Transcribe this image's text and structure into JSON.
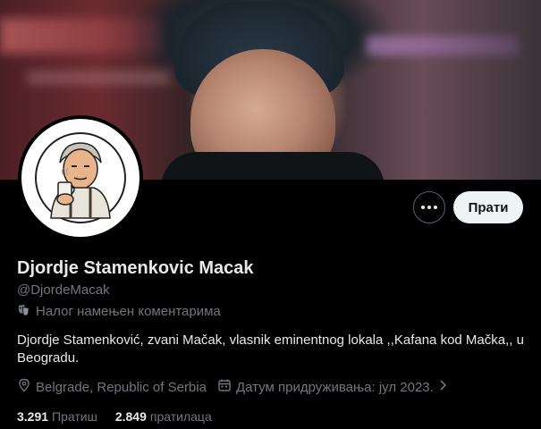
{
  "profile": {
    "name": "Djordje Stamenkovic Macak",
    "handle": "@DjordeMacak",
    "account_label": "Налог намењен коментарима",
    "bio": "Djordje Stamenković, zvani Mačak, vlasnik eminentnog lokala ,,Kafana kod Mačka,, u Beogradu.",
    "location": "Belgrade, Republic of Serbia",
    "joined": "Датум придруживања: јул 2023."
  },
  "actions": {
    "follow_label": "Прати",
    "more_icon": "more-horizontal-icon"
  },
  "stats": {
    "following_count": "3.291",
    "following_label": "Пратиш",
    "followers_count": "2.849",
    "followers_label": "пратилаца"
  },
  "colors": {
    "background": "#000000",
    "primary_text": "#e7e9ea",
    "secondary_text": "#71767b",
    "follow_button_bg": "#eff3f4"
  }
}
